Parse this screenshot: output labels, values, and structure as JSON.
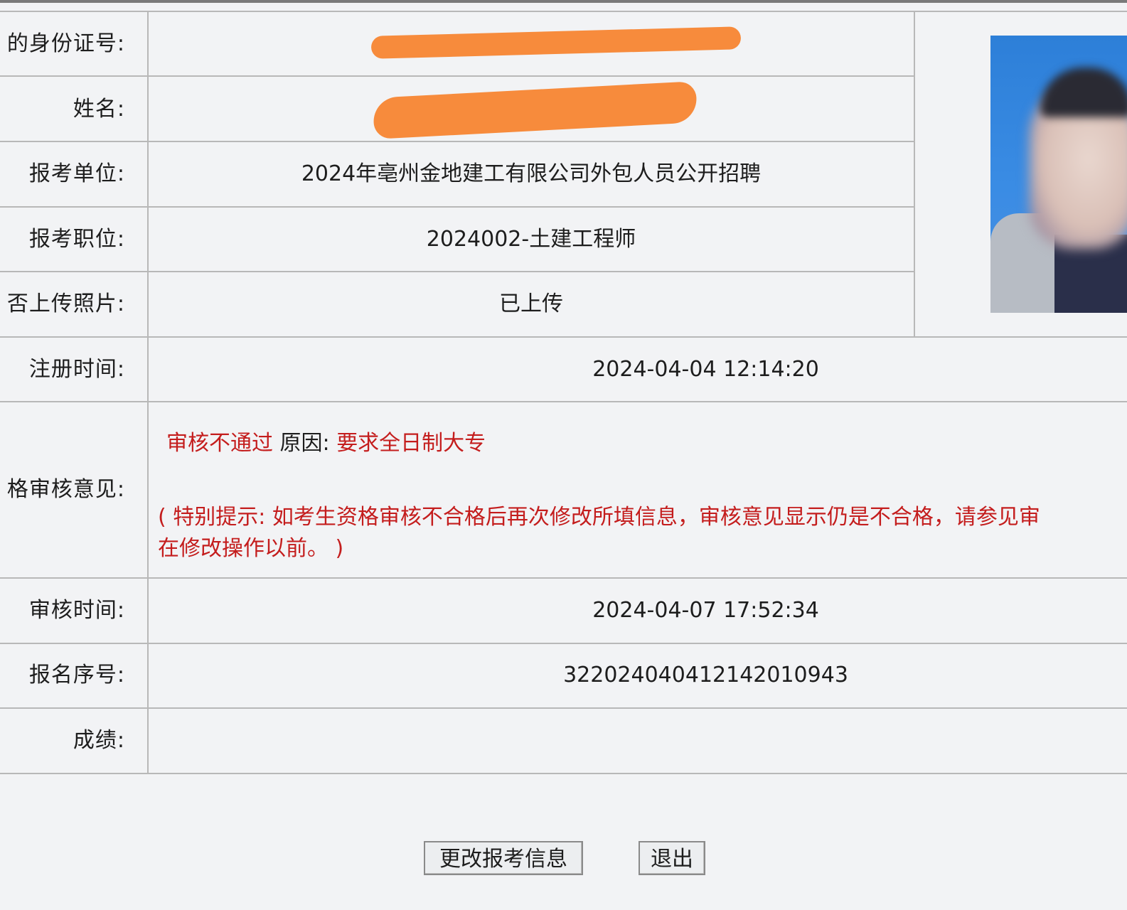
{
  "rows": {
    "id_number": {
      "label": "的身份证号:",
      "value": ""
    },
    "name": {
      "label": "姓名:",
      "value": ""
    },
    "unit": {
      "label": "报考单位:",
      "value": "2024年亳州金地建工有限公司外包人员公开招聘"
    },
    "position": {
      "label": "报考职位:",
      "value": "2024002-土建工程师"
    },
    "photo_uploaded": {
      "label": "否上传照片:",
      "value": "已上传"
    },
    "register_time": {
      "label": "注册时间:",
      "value": "2024-04-04 12:14:20"
    },
    "review_opinion": {
      "label": "格审核意见:",
      "status": "审核不通过",
      "reason_label": " 原因: ",
      "reason": "要求全日制大专",
      "notice_line1": "( 特别提示: 如考生资格审核不合格后再次修改所填信息，审核意见显示仍是不合格，请参见审",
      "notice_line2": "在修改操作以前。 )"
    },
    "review_time": {
      "label": "审核时间:",
      "value": "2024-04-07 17:52:34"
    },
    "serial": {
      "label": "报名序号:",
      "value": "3220240404121420109​43"
    },
    "score": {
      "label": "成绩:",
      "value": ""
    }
  },
  "buttons": {
    "edit": "更改报考信息",
    "logout": "退出"
  },
  "colors": {
    "redact": "#f78b3c",
    "alert": "#c41d1d",
    "border": "#b8b8b8",
    "background": "#f2f3f5"
  }
}
